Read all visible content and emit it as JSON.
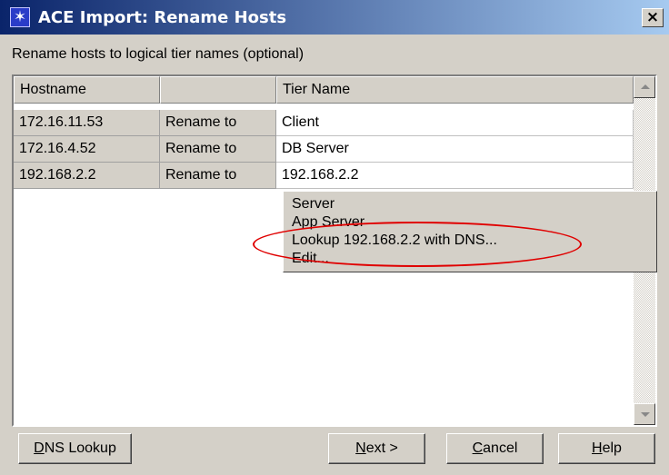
{
  "window": {
    "title": "ACE Import: Rename Hosts",
    "close_glyph": "×",
    "icon": "star-burst-icon"
  },
  "instruction": "Rename hosts to logical tier names (optional)",
  "table": {
    "columns": [
      "Hostname",
      "",
      "Tier Name"
    ],
    "rows": [
      {
        "hostname": "172.16.11.53",
        "action": "Rename to",
        "tier": "Client",
        "selected": false
      },
      {
        "hostname": "172.16.4.52",
        "action": "Rename to",
        "tier": "DB Server",
        "selected": false
      },
      {
        "hostname": "192.168.2.2",
        "action": "Rename to",
        "tier": "192.168.2.2",
        "selected": true
      }
    ]
  },
  "context_menu": {
    "items": [
      "Server",
      "App Server",
      "Lookup 192.168.2.2 with DNS...",
      "Edit..."
    ],
    "highlighted_item": "Lookup 192.168.2.2 with DNS...",
    "highlight_color": "#e00000"
  },
  "buttons": {
    "dns_lookup": {
      "mnemonic": "D",
      "rest": "NS Lookup"
    },
    "next": {
      "mnemonic": "N",
      "rest": "ext >"
    },
    "cancel": {
      "mnemonic": "C",
      "rest": "ancel"
    },
    "help": {
      "mnemonic": "H",
      "rest": "elp"
    }
  },
  "colors": {
    "title_gradient_start": "#0a246a",
    "title_gradient_end": "#a6caf0",
    "dialog_face": "#d4d0c8",
    "selection": "#0a246a"
  }
}
